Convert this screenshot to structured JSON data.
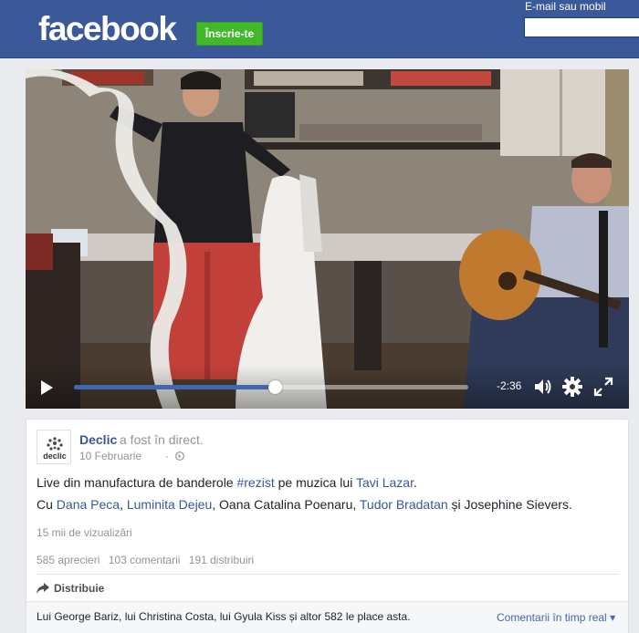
{
  "header": {
    "logo": "facebook",
    "signup_label": "Înscrie-te",
    "email_label": "E-mail sau mobil",
    "email_value": ""
  },
  "video": {
    "time_remaining": "-2:36",
    "progress": 0.51,
    "icons": [
      "play-icon",
      "volume-icon",
      "gear-icon",
      "fullscreen-icon"
    ]
  },
  "post": {
    "page_name": "Declic",
    "action": "a fost în direct.",
    "date": "10 Februarie",
    "date_separator": "·",
    "avatar_text": "declic",
    "text_line1": {
      "prefix": "Live din manufactura de banderole ",
      "hashtag": "#rezist",
      "middle": " pe muzica lui ",
      "artist": "Tavi Lazar",
      "suffix": "."
    },
    "text_line2": {
      "prefix": "Cu ",
      "person1": "Dana Peca",
      "sep1": ", ",
      "person2": "Luminita Dejeu",
      "sep2": ", Oana Catalina Poenaru, ",
      "person3": "Tudor Bradatan",
      "suffix": " și Josephine Sievers."
    },
    "views": "15 mii de vizualizări",
    "reactions": "585 aprecieri",
    "comments": "103 comentarii",
    "shares": "191 distribuiri",
    "share_label": "Distribuie",
    "likes_summary": "Lui George Bariz, lui Christina Costa, lui Gyula Kiss și altor 582 le place asta.",
    "comments_sort": "Comentarii în timp real"
  },
  "colors": {
    "brand_blue": "#3b5998",
    "signup_green": "#42b72a",
    "link_blue": "#365899"
  }
}
